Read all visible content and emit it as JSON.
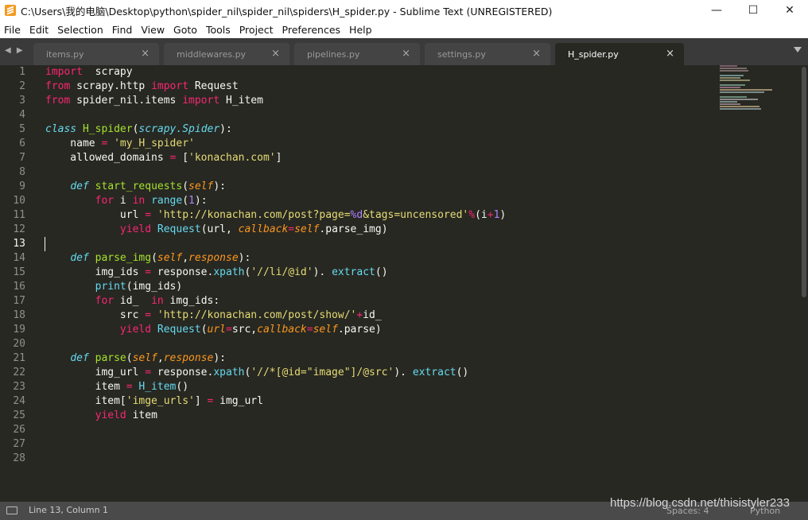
{
  "window": {
    "title": "C:\\Users\\我的电脑\\Desktop\\python\\spider_nil\\spider_nil\\spiders\\H_spider.py - Sublime Text (UNREGISTERED)",
    "minimize": "—",
    "maximize": "☐",
    "close": "✕"
  },
  "menu": [
    "File",
    "Edit",
    "Selection",
    "Find",
    "View",
    "Goto",
    "Tools",
    "Project",
    "Preferences",
    "Help"
  ],
  "tabs": [
    {
      "label": "items.py",
      "close": "×",
      "active": false
    },
    {
      "label": "middlewares.py",
      "close": "×",
      "active": false
    },
    {
      "label": "pipelines.py",
      "close": "×",
      "active": false
    },
    {
      "label": "settings.py",
      "close": "×",
      "active": false
    },
    {
      "label": "H_spider.py",
      "close": "×",
      "active": true
    }
  ],
  "tab_arrows": "◀ ▶",
  "line_numbers": [
    "1",
    "2",
    "3",
    "4",
    "5",
    "6",
    "7",
    "8",
    "9",
    "10",
    "11",
    "12",
    "13",
    "14",
    "15",
    "16",
    "17",
    "18",
    "19",
    "20",
    "21",
    "22",
    "23",
    "24",
    "25",
    "26",
    "27",
    "28"
  ],
  "code_lines": [
    [
      [
        "kw",
        "import"
      ],
      [
        "",
        "  scrapy"
      ]
    ],
    [
      [
        "kw",
        "from"
      ],
      [
        "",
        " scrapy.http "
      ],
      [
        "kw",
        "import"
      ],
      [
        "",
        " Request"
      ]
    ],
    [
      [
        "kw",
        "from"
      ],
      [
        "",
        " spider_nil.items "
      ],
      [
        "kw",
        "import"
      ],
      [
        "",
        " H_item"
      ]
    ],
    [],
    [
      [
        "cls",
        "class"
      ],
      [
        "",
        " "
      ],
      [
        "fn",
        "H_spider"
      ],
      [
        "",
        "("
      ],
      [
        "cls",
        "scrapy.Spider"
      ],
      [
        "",
        "):"
      ]
    ],
    [
      [
        "",
        "    name "
      ],
      [
        "kw",
        "="
      ],
      [
        "",
        " "
      ],
      [
        "st",
        "'my_H_spider'"
      ]
    ],
    [
      [
        "",
        "    allowed_domains "
      ],
      [
        "kw",
        "="
      ],
      [
        "",
        " ["
      ],
      [
        "st",
        "'konachan.com'"
      ],
      [
        "",
        "]"
      ]
    ],
    [],
    [
      [
        "",
        "    "
      ],
      [
        "cls",
        "def"
      ],
      [
        "",
        " "
      ],
      [
        "fn",
        "start_requests"
      ],
      [
        "",
        "("
      ],
      [
        "it",
        "self"
      ],
      [
        "",
        "):"
      ]
    ],
    [
      [
        "",
        "        "
      ],
      [
        "kw",
        "for"
      ],
      [
        "",
        " i "
      ],
      [
        "kw",
        "in"
      ],
      [
        "",
        " "
      ],
      [
        "bi",
        "range"
      ],
      [
        "",
        "("
      ],
      [
        "nm",
        "1"
      ],
      [
        "",
        "):"
      ]
    ],
    [
      [
        "",
        "            url "
      ],
      [
        "kw",
        "="
      ],
      [
        "",
        " "
      ],
      [
        "st",
        "'http://konachan.com/post?page="
      ],
      [
        "sp",
        "%d"
      ],
      [
        "st",
        "&tags=uncensored'"
      ],
      [
        "kw",
        "%"
      ],
      [
        "",
        "(i"
      ],
      [
        "kw",
        "+"
      ],
      [
        "nm",
        "1"
      ],
      [
        "",
        ")"
      ]
    ],
    [
      [
        "",
        "            "
      ],
      [
        "kw",
        "yield"
      ],
      [
        "",
        " "
      ],
      [
        "bi",
        "Request"
      ],
      [
        "",
        "(url, "
      ],
      [
        "it",
        "callback"
      ],
      [
        "kw",
        "="
      ],
      [
        "it",
        "self"
      ],
      [
        "",
        ".parse_img)"
      ]
    ],
    [],
    [
      [
        "",
        "    "
      ],
      [
        "cls",
        "def"
      ],
      [
        "",
        " "
      ],
      [
        "fn",
        "parse_img"
      ],
      [
        "",
        "("
      ],
      [
        "it",
        "self"
      ],
      [
        "",
        ","
      ],
      [
        "it",
        "response"
      ],
      [
        "",
        "):"
      ]
    ],
    [
      [
        "",
        "        img_ids "
      ],
      [
        "kw",
        "="
      ],
      [
        "",
        " response."
      ],
      [
        "bi",
        "xpath"
      ],
      [
        "",
        "("
      ],
      [
        "st",
        "'//li/@id'"
      ],
      [
        "",
        "). "
      ],
      [
        "bi",
        "extract"
      ],
      [
        "",
        "()"
      ]
    ],
    [
      [
        "",
        "        "
      ],
      [
        "bi",
        "print"
      ],
      [
        "",
        "(img_ids)"
      ]
    ],
    [
      [
        "",
        "        "
      ],
      [
        "kw",
        "for"
      ],
      [
        "",
        " id_  "
      ],
      [
        "kw",
        "in"
      ],
      [
        "",
        " img_ids:"
      ]
    ],
    [
      [
        "",
        "            src "
      ],
      [
        "kw",
        "="
      ],
      [
        "",
        " "
      ],
      [
        "st",
        "'http://konachan.com/post/show/'"
      ],
      [
        "kw",
        "+"
      ],
      [
        "",
        "id_"
      ]
    ],
    [
      [
        "",
        "            "
      ],
      [
        "kw",
        "yield"
      ],
      [
        "",
        " "
      ],
      [
        "bi",
        "Request"
      ],
      [
        "",
        "("
      ],
      [
        "it",
        "url"
      ],
      [
        "kw",
        "="
      ],
      [
        "",
        "src,"
      ],
      [
        "it",
        "callback"
      ],
      [
        "kw",
        "="
      ],
      [
        "it",
        "self"
      ],
      [
        "",
        ".parse)"
      ]
    ],
    [],
    [
      [
        "",
        "    "
      ],
      [
        "cls",
        "def"
      ],
      [
        "",
        " "
      ],
      [
        "fn",
        "parse"
      ],
      [
        "",
        "("
      ],
      [
        "it",
        "self"
      ],
      [
        "",
        ","
      ],
      [
        "it",
        "response"
      ],
      [
        "",
        "):"
      ]
    ],
    [
      [
        "",
        "        img_url "
      ],
      [
        "kw",
        "="
      ],
      [
        "",
        " response."
      ],
      [
        "bi",
        "xpath"
      ],
      [
        "",
        "("
      ],
      [
        "st",
        "'//*[@id=\"image\"]/@src'"
      ],
      [
        "",
        "). "
      ],
      [
        "bi",
        "extract"
      ],
      [
        "",
        "()"
      ]
    ],
    [
      [
        "",
        "        item "
      ],
      [
        "kw",
        "="
      ],
      [
        "",
        " "
      ],
      [
        "bi",
        "H_item"
      ],
      [
        "",
        "()"
      ]
    ],
    [
      [
        "",
        "        item["
      ],
      [
        "st",
        "'imge_urls'"
      ],
      [
        "",
        "] "
      ],
      [
        "kw",
        "="
      ],
      [
        "",
        " img_url"
      ]
    ],
    [
      [
        "",
        "        "
      ],
      [
        "kw",
        "yield"
      ],
      [
        "",
        " item"
      ]
    ],
    [],
    [],
    []
  ],
  "status": {
    "position": "Line 13, Column 1",
    "spaces": "Spaces: 4",
    "syntax": "Python"
  },
  "watermark": "https://blog.csdn.net/thisistyler233",
  "colors": {
    "editor_bg": "#272822",
    "keyword": "#f92672",
    "builtin": "#66d9ef",
    "function": "#a6e22e",
    "param": "#fd971f",
    "string": "#e6db74",
    "number": "#ae81ff"
  }
}
